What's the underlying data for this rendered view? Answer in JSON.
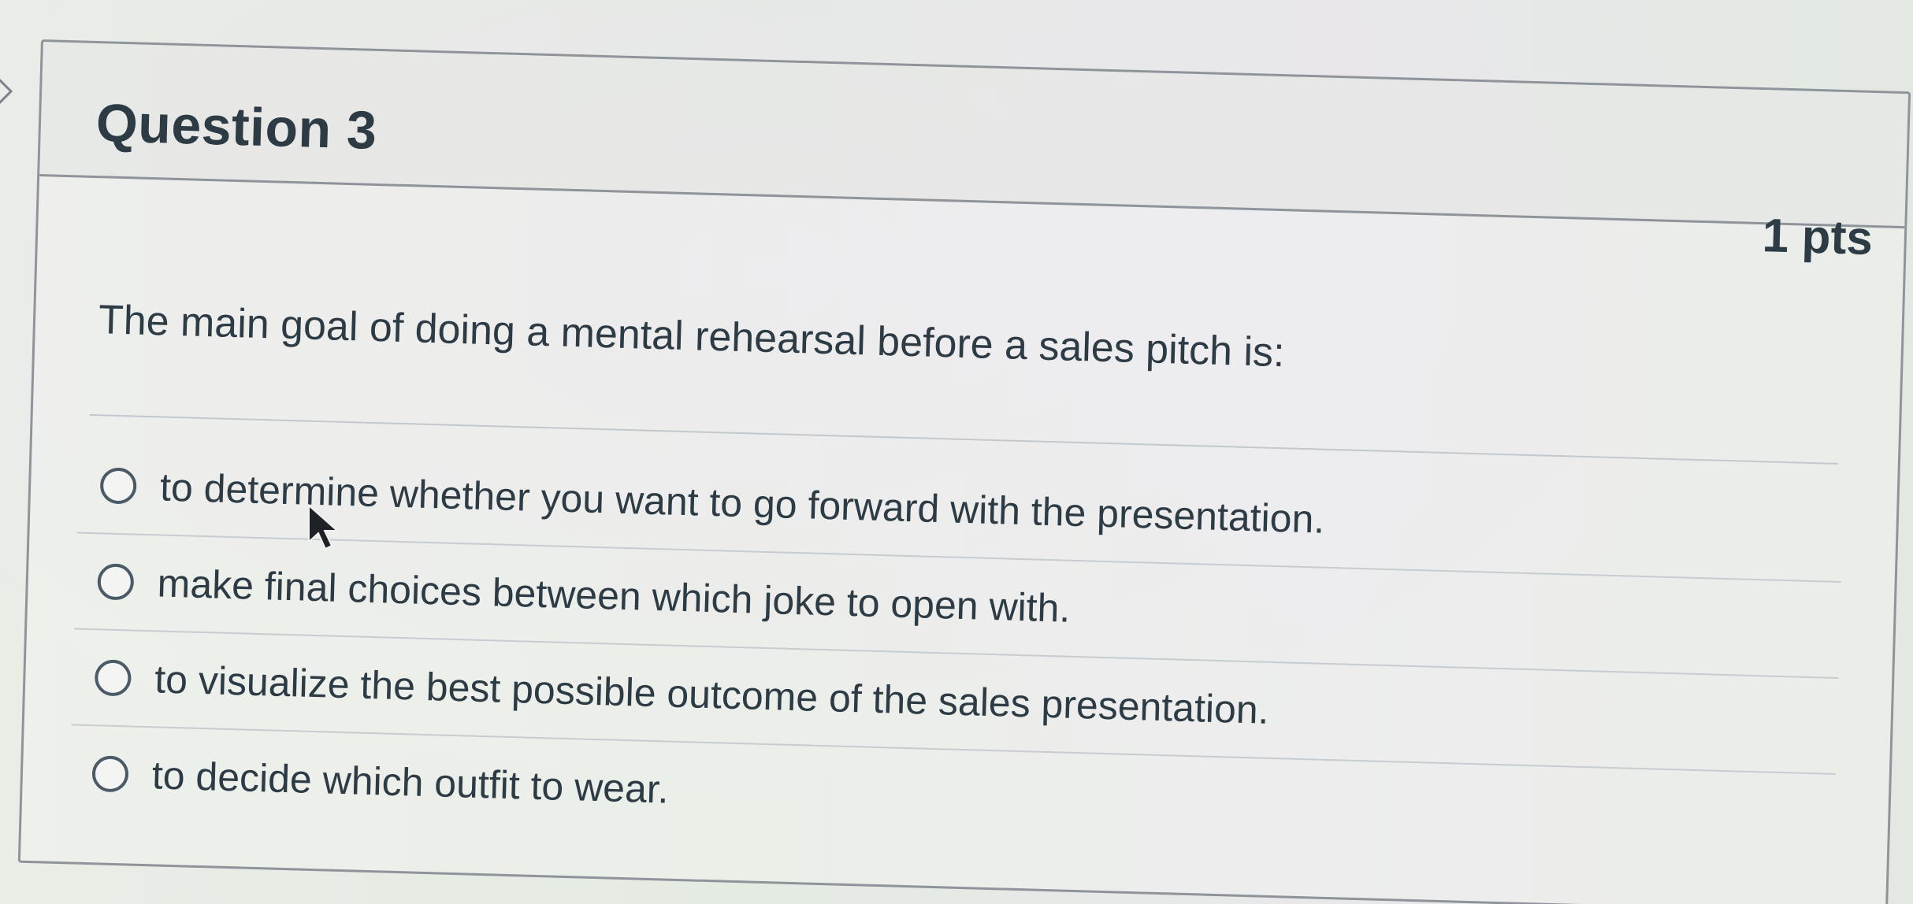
{
  "question": {
    "title": "Question 3",
    "points": "1 pts",
    "text": "The main goal of doing a mental rehearsal before a sales pitch is:"
  },
  "answers": [
    {
      "label": "to determine whether you want to go forward with the presentation.",
      "selected": false
    },
    {
      "label": "make final choices between which joke to open with.",
      "selected": false
    },
    {
      "label": "to visualize the best possible outcome of the sales presentation.",
      "selected": false
    },
    {
      "label": "to decide which outfit to wear.",
      "selected": false
    }
  ],
  "icons": {
    "cursor": "mouse-pointer-icon",
    "nav": "chevron-right-icon",
    "radio": "radio-button-icon"
  },
  "colors": {
    "text": "#2d3b45",
    "border": "#8e9499",
    "radio_border": "#4a5a66"
  }
}
